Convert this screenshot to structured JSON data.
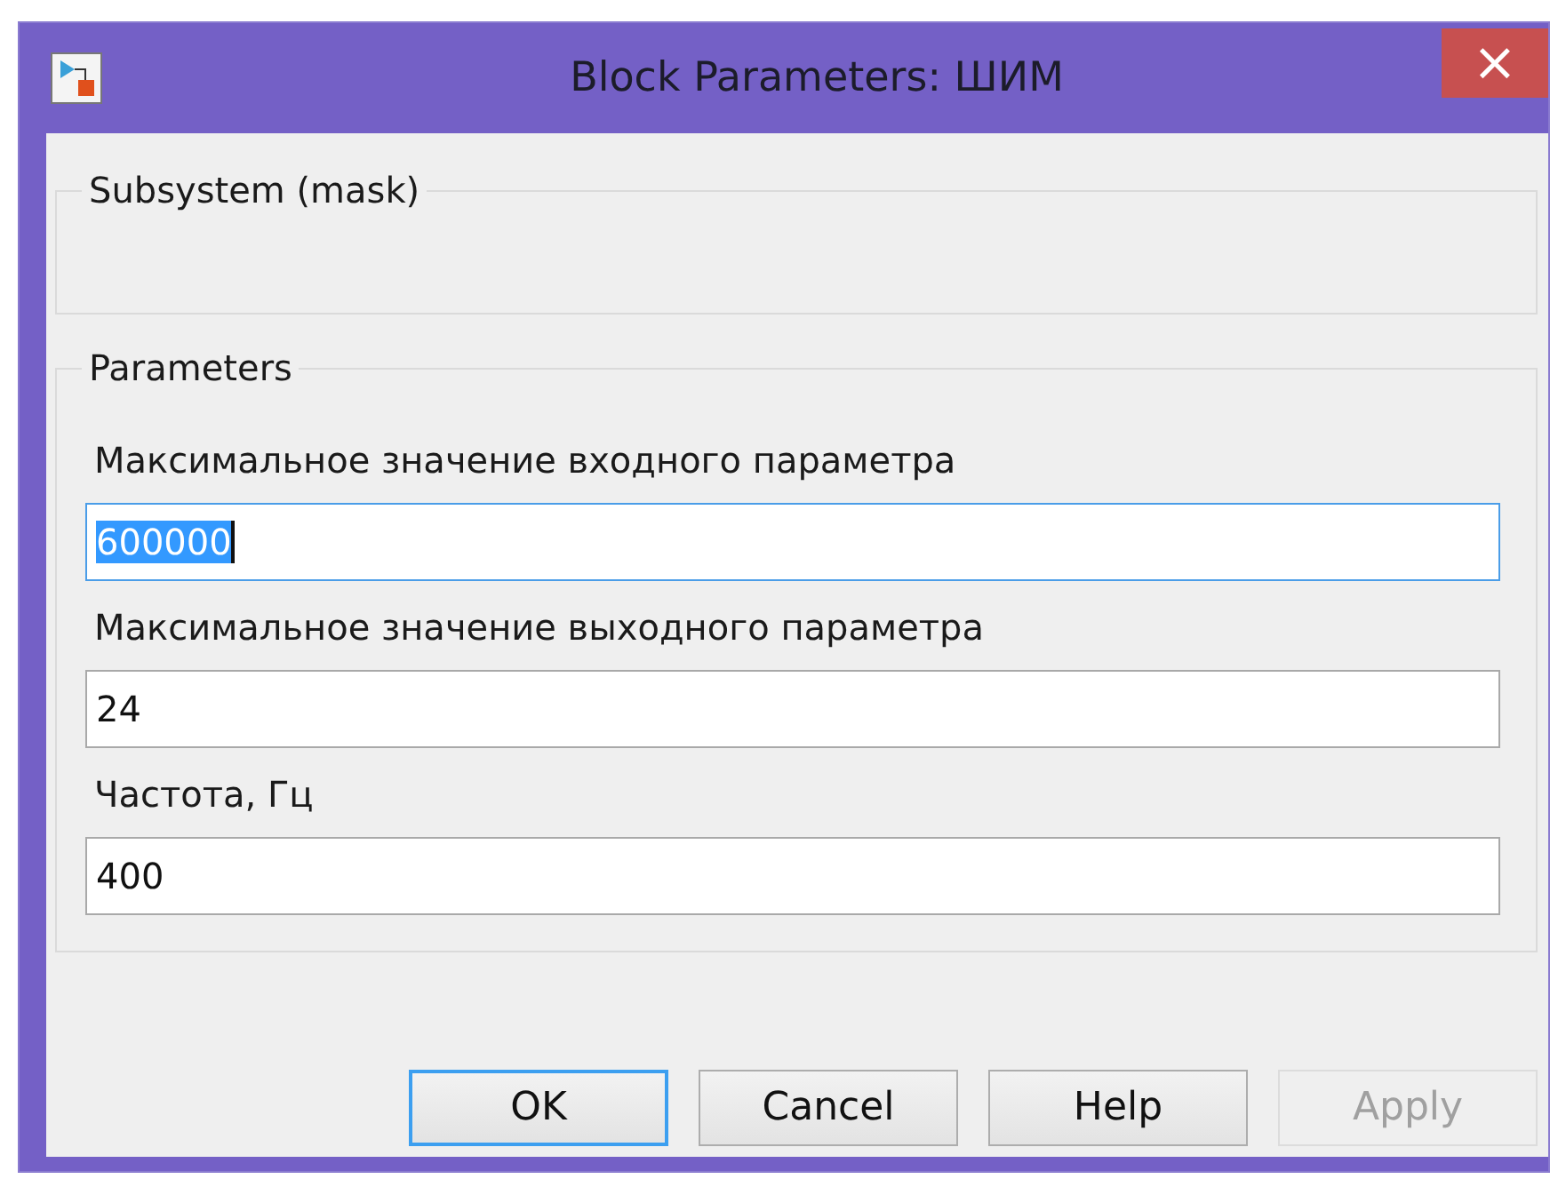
{
  "window": {
    "title": "Block Parameters: ШИМ",
    "close": "×"
  },
  "description_group": {
    "title": "Subsystem (mask)"
  },
  "parameters_group": {
    "title": "Parameters",
    "fields": [
      {
        "label": "Максимальное значение входного параметра",
        "value": "600000",
        "focused": true
      },
      {
        "label": "Максимальное значение выходного параметра",
        "value": "24",
        "focused": false
      },
      {
        "label": "Частота, Гц",
        "value": "400",
        "focused": false
      }
    ]
  },
  "buttons": [
    {
      "label": "OK",
      "default": true,
      "disabled": false
    },
    {
      "label": "Cancel",
      "default": false,
      "disabled": false
    },
    {
      "label": "Help",
      "default": false,
      "disabled": false
    },
    {
      "label": "Apply",
      "default": false,
      "disabled": true
    }
  ]
}
